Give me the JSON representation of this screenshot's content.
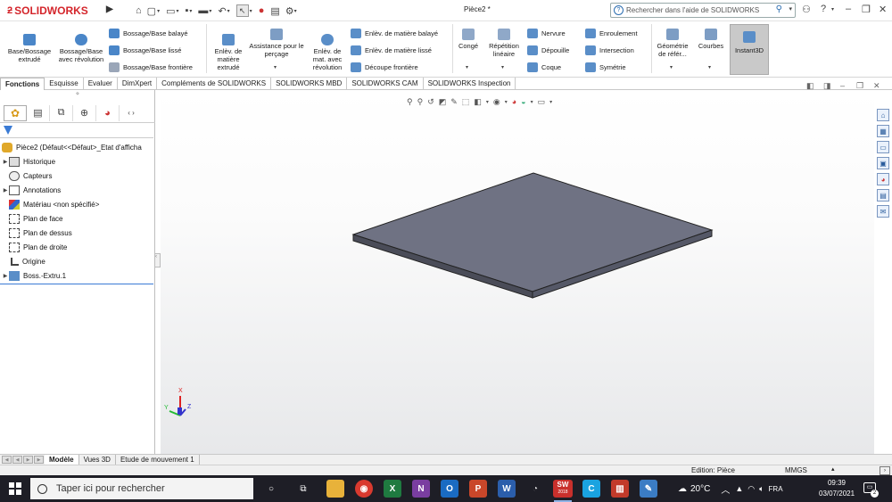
{
  "app": {
    "brand": "SOLIDWORKS",
    "document_title": "Pièce2 *",
    "help_search_placeholder": "Rechercher dans l'aide de SOLIDWORKS"
  },
  "ribbon": {
    "boss_extrude": "Base/Bossage extrudé",
    "boss_revolve": "Bossage/Base avec révolution",
    "swept_boss": "Bossage/Base balayé",
    "lofted_boss": "Bossage/Base lissé",
    "boundary_boss": "Bossage/Base frontière",
    "extruded_cut": "Enlèv. de matière extrudé",
    "hole_wizard": "Assistance pour le perçage",
    "revolved_cut": "Enlèv. de mat. avec révolution",
    "swept_cut": "Enlèv. de matière balayé",
    "lofted_cut": "Enlèv. de matière lissé",
    "boundary_cut": "Découpe frontière",
    "fillet": "Congé",
    "linear_pattern": "Répétition linéaire",
    "rib": "Nervure",
    "draft": "Dépouille",
    "shell": "Coque",
    "wrap": "Enroulement",
    "intersect": "Intersection",
    "mirror": "Symétrie",
    "ref_geometry": "Géométrie de référ...",
    "curves": "Courbes",
    "instant3d": "Instant3D"
  },
  "command_tabs": [
    "Fonctions",
    "Esquisse",
    "Evaluer",
    "DimXpert",
    "Compléments de SOLIDWORKS",
    "SOLIDWORKS MBD",
    "SOLIDWORKS CAM",
    "SOLIDWORKS Inspection"
  ],
  "feature_tree": {
    "root": "Pièce2  (Défaut<<Défaut>_Etat d'afficha",
    "items": [
      {
        "label": "Historique",
        "expandable": true
      },
      {
        "label": "Capteurs",
        "expandable": false
      },
      {
        "label": "Annotations",
        "expandable": true
      },
      {
        "label": "Matériau <non spécifié>",
        "expandable": false
      },
      {
        "label": "Plan de face",
        "expandable": false
      },
      {
        "label": "Plan de dessus",
        "expandable": false
      },
      {
        "label": "Plan de droite",
        "expandable": false
      },
      {
        "label": "Origine",
        "expandable": false
      },
      {
        "label": "Boss.-Extru.1",
        "expandable": true
      }
    ]
  },
  "triad": {
    "x": "X",
    "y": "Y",
    "z": "Z"
  },
  "bottom_tabs": [
    "Modèle",
    "Vues 3D",
    "Etude de mouvement 1"
  ],
  "status": {
    "edition": "Edition: Pièce",
    "units": "MMGS"
  },
  "taskbar": {
    "search_placeholder": "Taper ici pour rechercher",
    "sw_badge": "2018",
    "temperature": "20°C",
    "language": "FRA",
    "time": "09:39",
    "date": "03/07/2021",
    "notifications": "2"
  },
  "colors": {
    "brand_red": "#d4252b",
    "plate_top": "#6f7283",
    "plate_edge": "#4a4c58",
    "accent_blue": "#3a7bd5"
  }
}
